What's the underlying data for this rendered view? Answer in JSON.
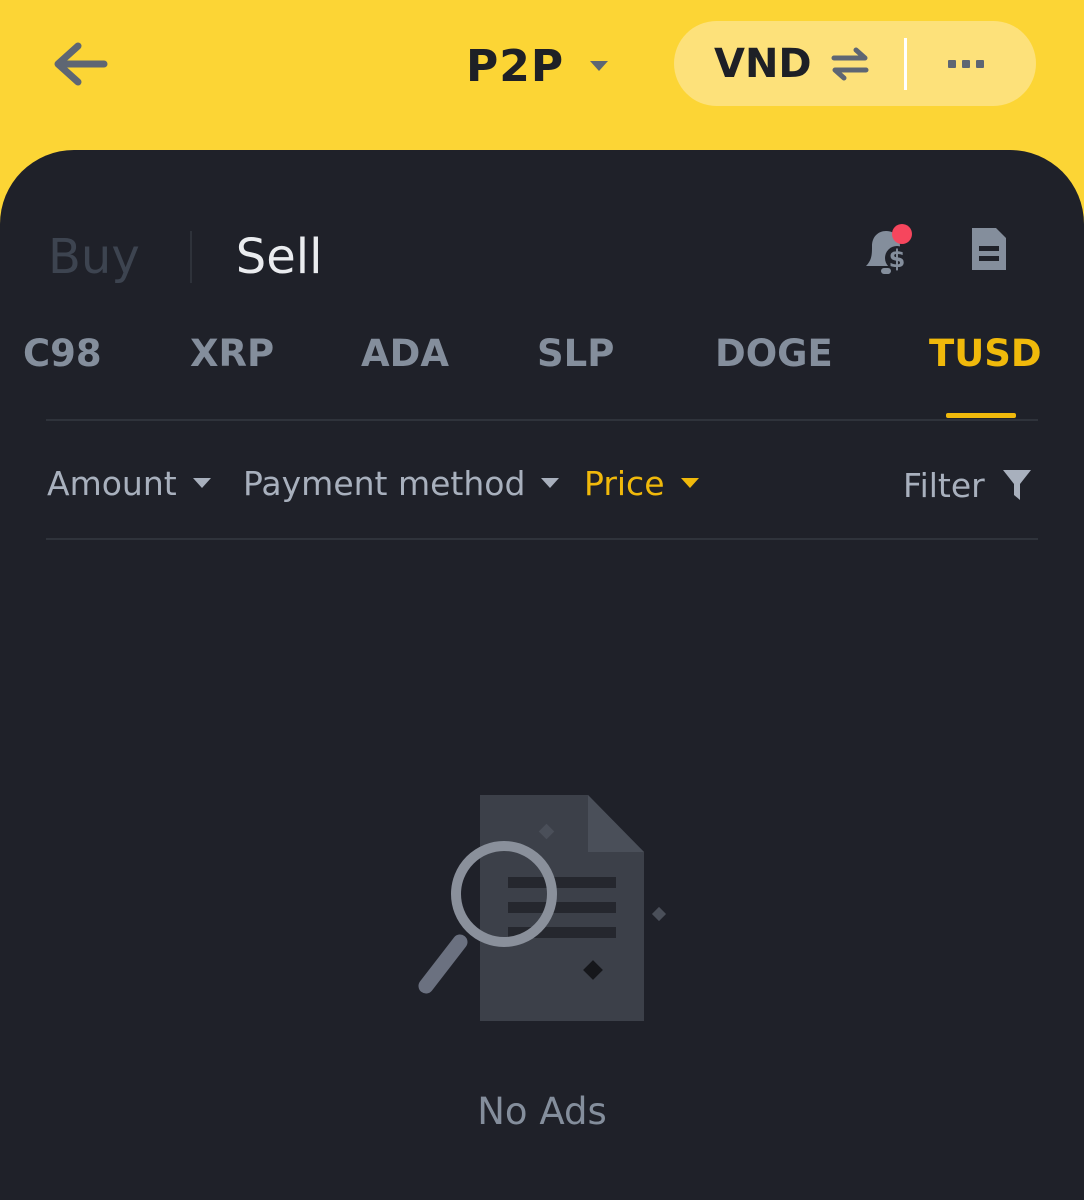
{
  "header": {
    "title": "P2P",
    "currency": "VND"
  },
  "trade_tabs": {
    "buy": "Buy",
    "sell": "Sell",
    "active": "Sell"
  },
  "coins": {
    "items": [
      "C98",
      "XRP",
      "ADA",
      "SLP",
      "DOGE",
      "TUSD"
    ],
    "active": "TUSD"
  },
  "filters": {
    "amount": "Amount",
    "payment_method": "Payment method",
    "price": "Price",
    "filter": "Filter"
  },
  "empty_state": {
    "message": "No Ads"
  },
  "colors": {
    "brand_yellow": "#fcd535",
    "accent": "#f0b90b",
    "panel_bg": "#1f2129",
    "badge": "#f6465d"
  },
  "icons": [
    "back-arrow-icon",
    "caret-down-icon",
    "swap-icon",
    "more-icon",
    "bell-dollar-icon",
    "order-document-icon",
    "funnel-icon",
    "empty-search-document-icon"
  ]
}
